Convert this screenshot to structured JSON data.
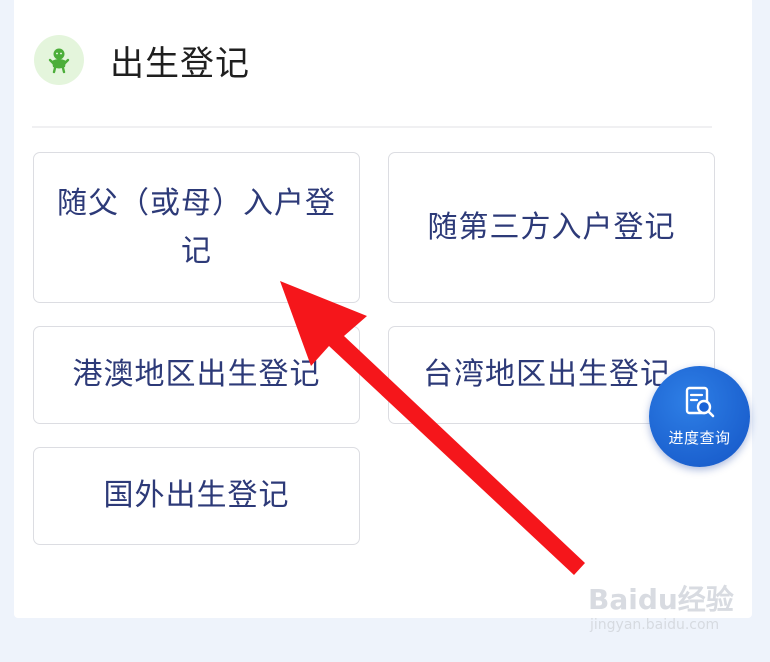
{
  "section": {
    "title": "出生登记",
    "icon": "baby-icon",
    "icon_color": "#4cae3a"
  },
  "options": [
    {
      "label": "随父（或母）入户登记"
    },
    {
      "label": "随第三方入户登记"
    },
    {
      "label": "港澳地区出生登记"
    },
    {
      "label": "台湾地区出生登记"
    },
    {
      "label": "国外出生登记"
    }
  ],
  "fab": {
    "label": "进度查询",
    "icon": "search-document-icon",
    "color": "#1a63d6"
  },
  "annotation": {
    "arrow_color": "#f5161b"
  },
  "watermark": {
    "brand": "Baidu经验",
    "url": "jingyan.baidu.com"
  },
  "colors": {
    "page_bg": "#eef3fb",
    "card_bg": "#ffffff",
    "option_text": "#2d3a78",
    "option_border": "#dcdde2"
  }
}
